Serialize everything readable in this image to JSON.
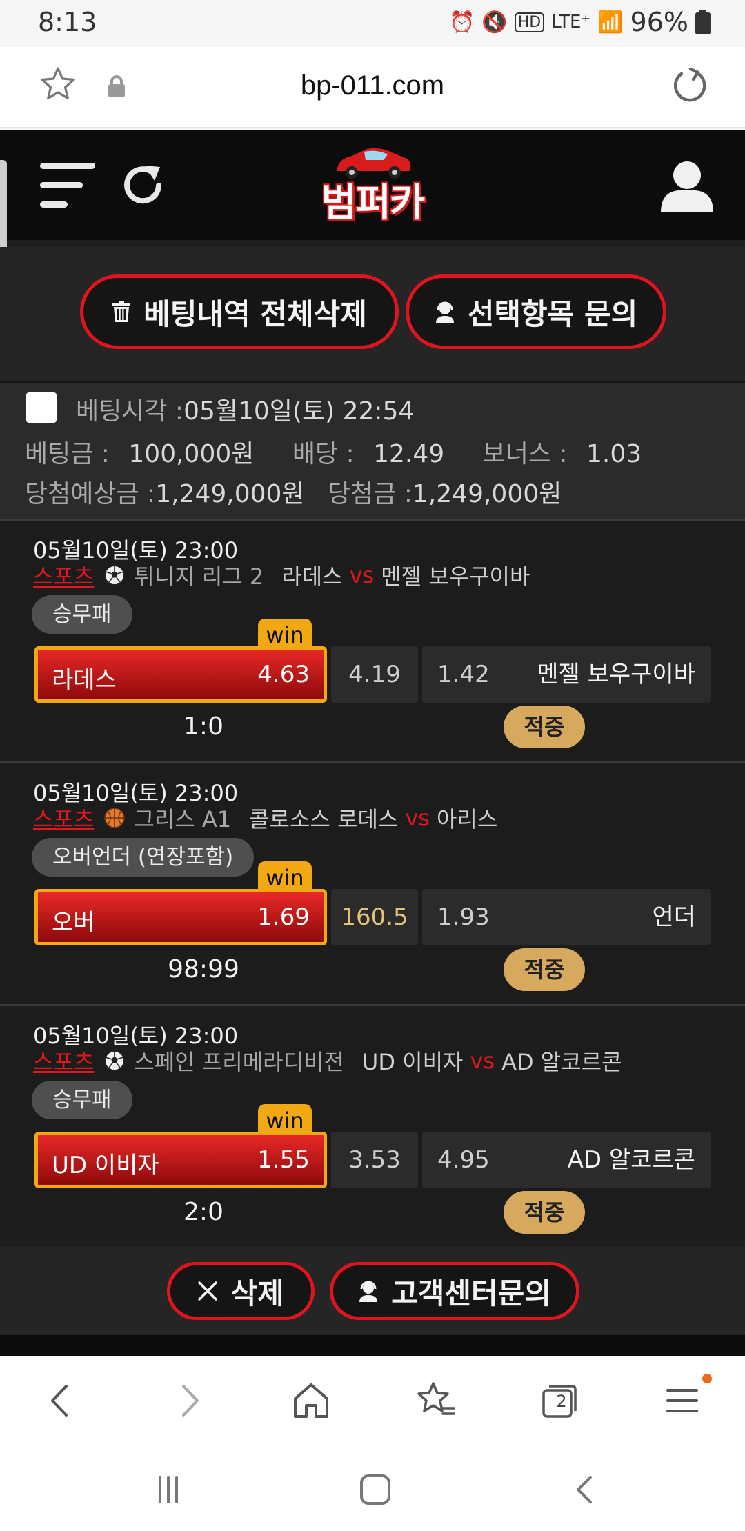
{
  "status": {
    "time": "8:13",
    "net": "LTE⁺",
    "battery": "96%"
  },
  "browser": {
    "url": "bp-011.com"
  },
  "site": {
    "logo": "범퍼카"
  },
  "actions": {
    "delete_all": "베팅내역 전체삭제",
    "inquiry_selected": "선택항목 문의"
  },
  "summary": {
    "time_label": "베팅시각 :",
    "time_value": "05월10일(토) 22:54",
    "amount_label": "베팅금 :",
    "amount_value": "100,000원",
    "odds_label": "배당 :",
    "odds_value": "12.49",
    "bonus_label": "보너스 :",
    "bonus_value": "1.03",
    "expected_label": "당첨예상금 :",
    "expected_value": "1,249,000원",
    "win_label": "당첨금 :",
    "win_value": "1,249,000원"
  },
  "bets": [
    {
      "datetime": "05월10일(토) 23:00",
      "sport_label": "스포츠",
      "ball_icon": "soccer-ball-icon",
      "league": "튀니지 리그 2",
      "home": "라데스",
      "vs": "vs",
      "away": "멘젤 보우구이바",
      "market": "승무패",
      "win_badge": "win",
      "pick_name": "라데스",
      "pick_odds": "4.63",
      "mid_value": "4.19",
      "other_odds": "1.42",
      "other_name": "멘젤 보우구이바",
      "score": "1:0",
      "result": "적중"
    },
    {
      "datetime": "05월10일(토) 23:00",
      "sport_label": "스포츠",
      "ball_icon": "basketball-icon",
      "league": "그리스 A1",
      "home": "콜로소스 로데스",
      "vs": "vs",
      "away": "아리스",
      "market": "오버언더 (연장포함)",
      "win_badge": "win",
      "pick_name": "오버",
      "pick_odds": "1.69",
      "mid_value": "160.5",
      "other_odds": "1.93",
      "other_name": "언더",
      "score": "98:99",
      "result": "적중"
    },
    {
      "datetime": "05월10일(토) 23:00",
      "sport_label": "스포츠",
      "ball_icon": "soccer-ball-icon",
      "league": "스페인 프리메라디비전",
      "home": "UD 이비자",
      "vs": "vs",
      "away": "AD 알코르콘",
      "market": "승무패",
      "win_badge": "win",
      "pick_name": "UD 이비자",
      "pick_odds": "1.55",
      "mid_value": "3.53",
      "other_odds": "4.95",
      "other_name": "AD 알코르콘",
      "score": "2:0",
      "result": "적중"
    }
  ],
  "footer_actions": {
    "delete": "삭제",
    "support": "고객센터문의"
  },
  "bottom_nav": {
    "tabs_count": "2"
  },
  "colors": {
    "accent_red": "#e0141e",
    "win_gold": "#f2a812",
    "hit_tan": "#d6a95e"
  }
}
